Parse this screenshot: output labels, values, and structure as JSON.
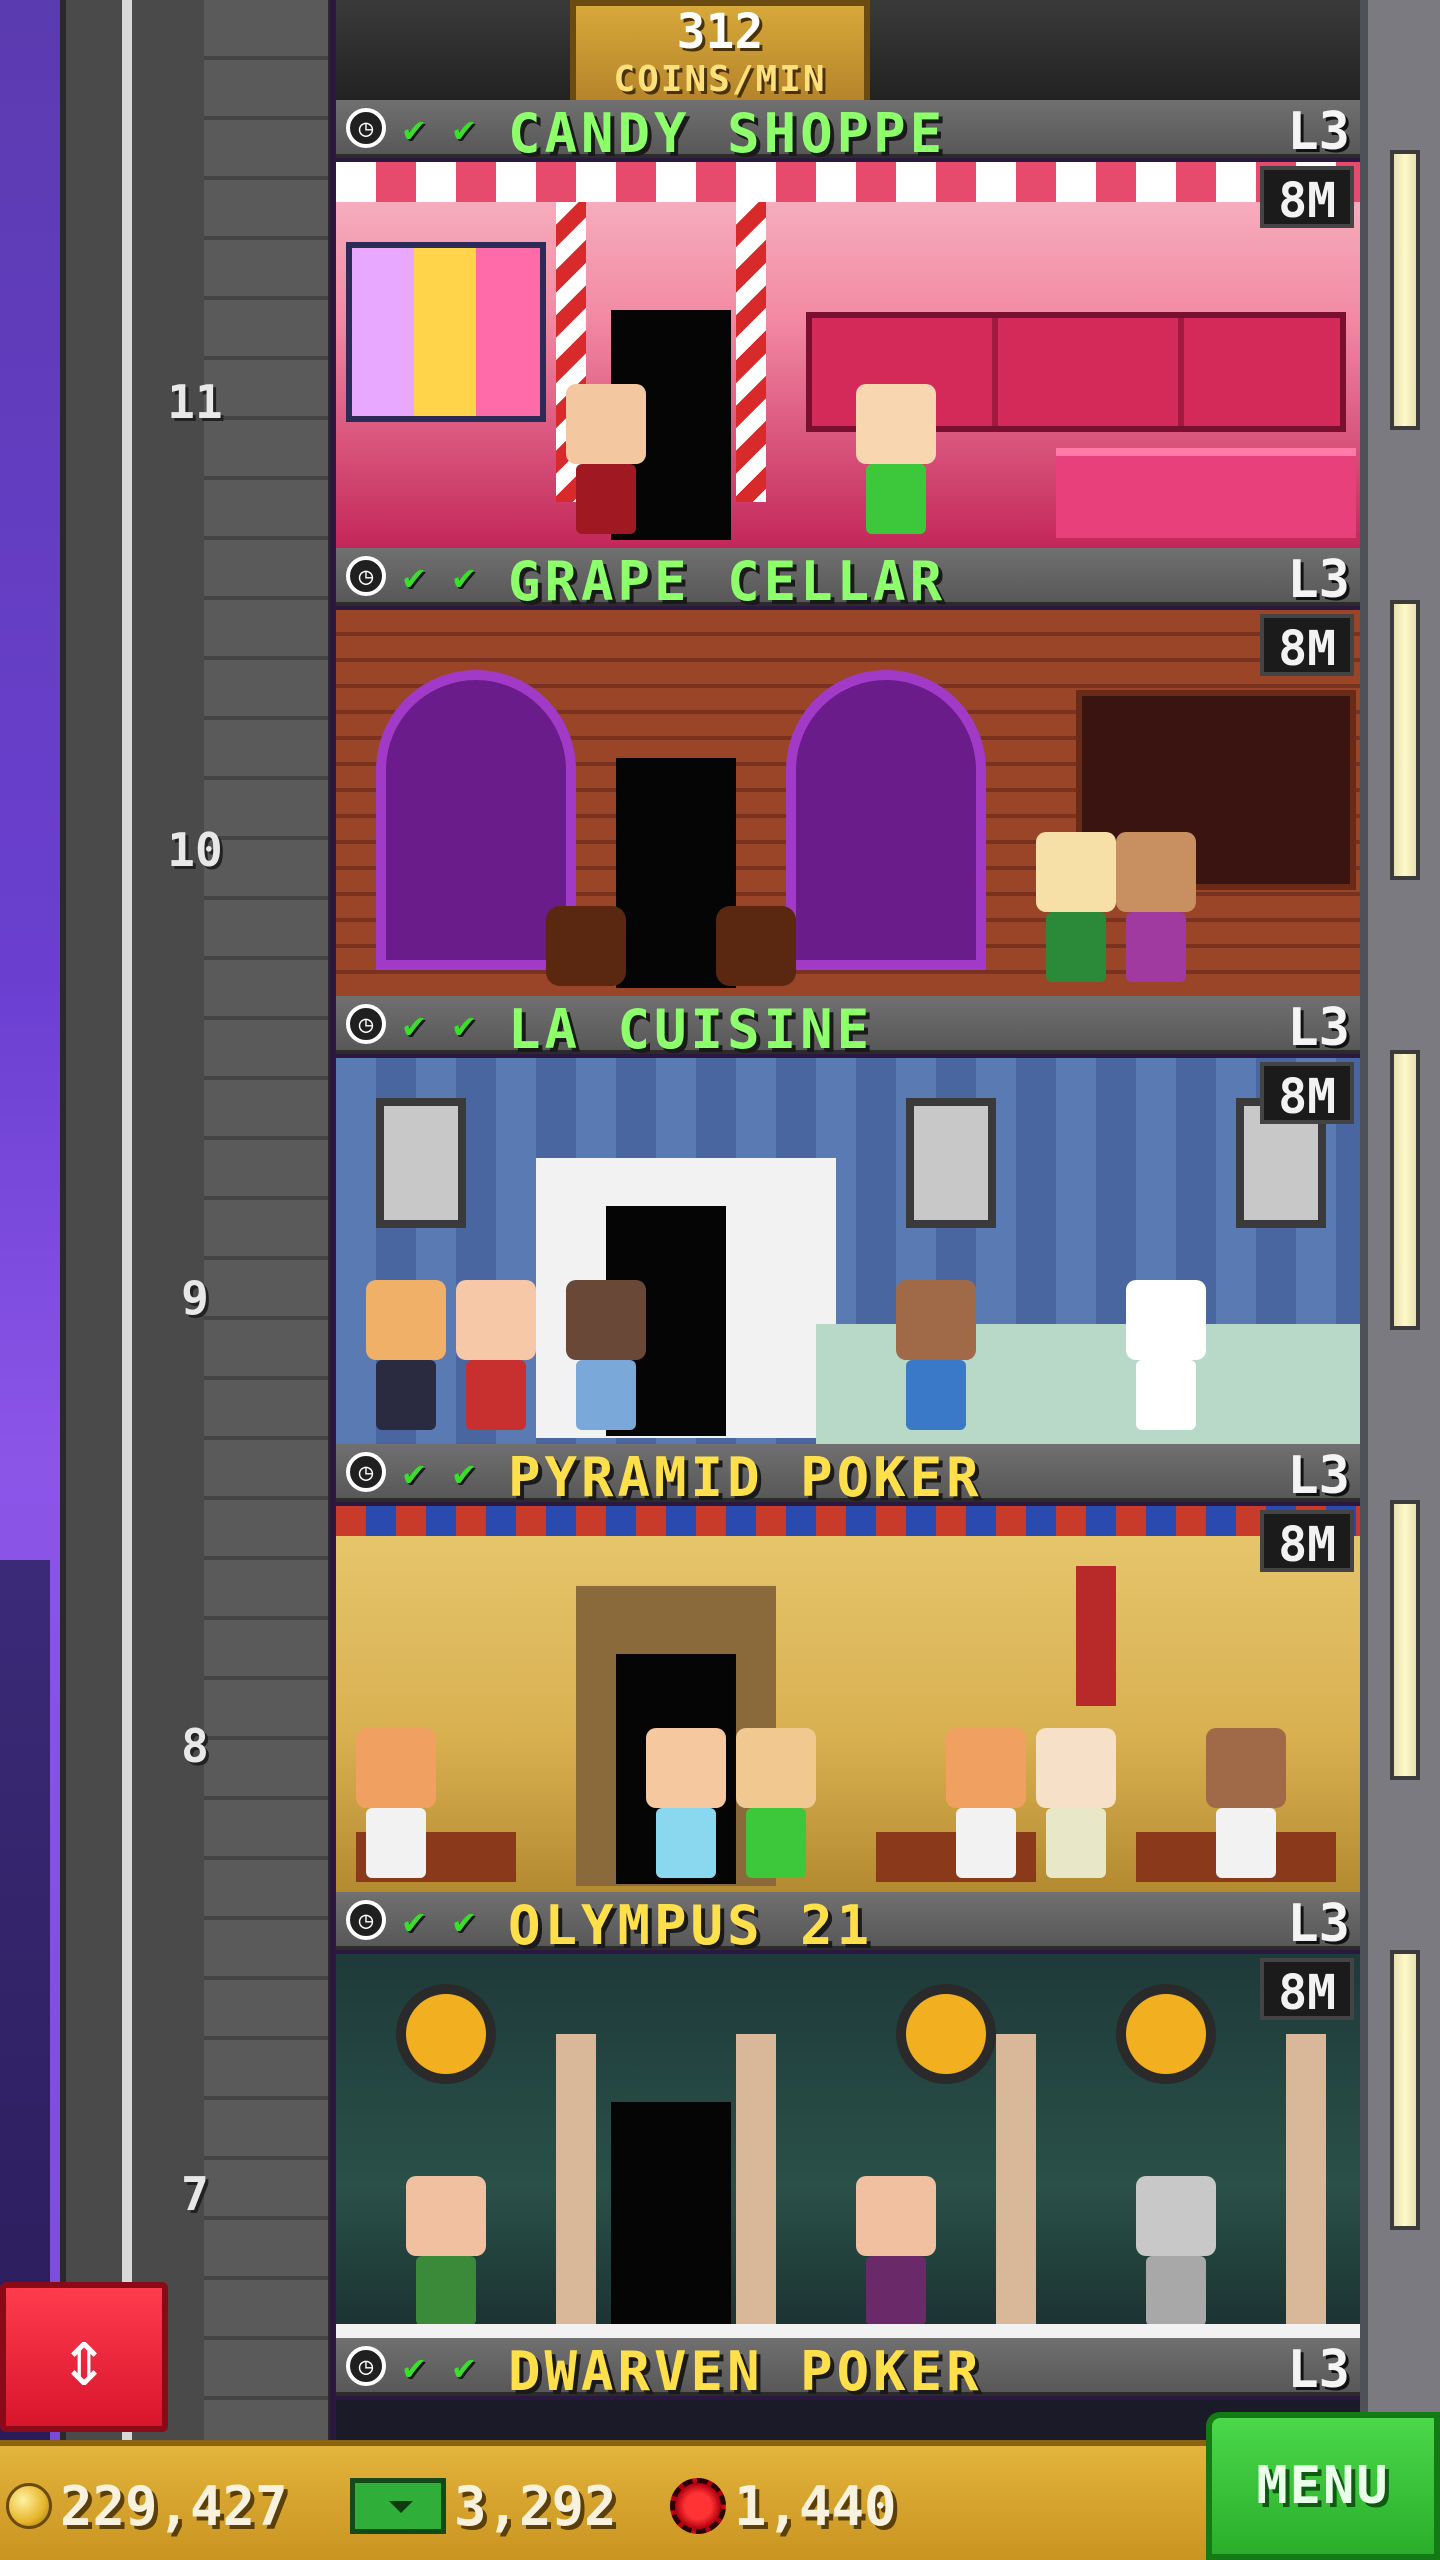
{
  "header": {
    "coins_per_min_value": "312",
    "coins_per_min_label": "COINS/MIN"
  },
  "floors": [
    {
      "number": "11",
      "name": "CANDY SHOPPE",
      "name_color": "#8dff6a",
      "level": "L3",
      "timer": "8M",
      "status_icons": [
        "clock-icon",
        "check-icon",
        "check-icon"
      ]
    },
    {
      "number": "10",
      "name": "GRAPE CELLAR",
      "name_color": "#8dff6a",
      "level": "L3",
      "timer": "8M",
      "status_icons": [
        "clock-icon",
        "check-icon",
        "check-icon"
      ]
    },
    {
      "number": "9",
      "name": "LA CUISINE",
      "name_color": "#8dff6a",
      "level": "L3",
      "timer": "8M",
      "status_icons": [
        "clock-icon",
        "check-icon",
        "check-icon"
      ]
    },
    {
      "number": "8",
      "name": "PYRAMID POKER",
      "name_color": "#ffe04a",
      "level": "L3",
      "timer": "8M",
      "status_icons": [
        "clock-icon",
        "check-icon",
        "check-icon"
      ]
    },
    {
      "number": "7",
      "name": "OLYMPUS 21",
      "name_color": "#ffe04a",
      "level": "L3",
      "timer": "8M",
      "status_icons": [
        "clock-icon",
        "check-icon",
        "check-icon"
      ]
    },
    {
      "name": "DWARVEN POKER",
      "name_color": "#ffe04a",
      "level": "L3",
      "status_icons": [
        "clock-icon",
        "check-icon",
        "check-icon"
      ]
    }
  ],
  "status_bar": {
    "coins": "229,427",
    "bux": "3,292",
    "chips": "1,440",
    "menu_label": "MENU"
  },
  "colors": {
    "status_bar": "#d4a42e",
    "menu_button": "#3cc43a",
    "elevator_button": "#e8203a",
    "green_text": "#8dff6a",
    "yellow_text": "#ffe04a"
  }
}
